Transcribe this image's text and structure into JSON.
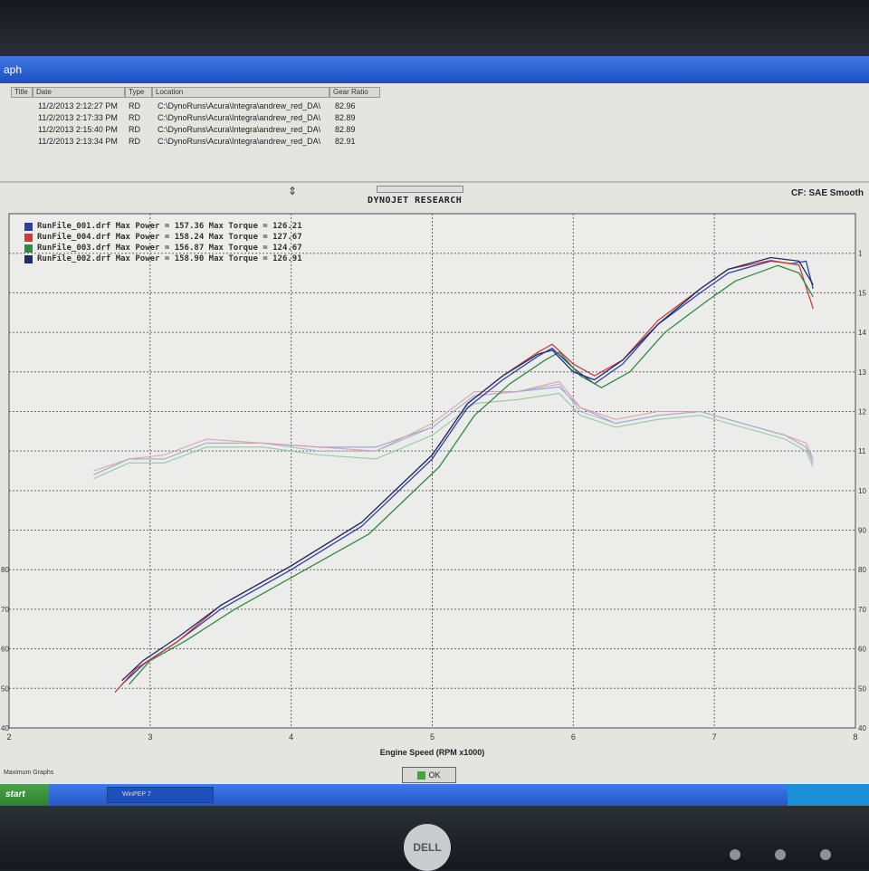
{
  "window": {
    "title": "aph"
  },
  "runs_table": {
    "headers": [
      "Title",
      "Date",
      "Type",
      "Location",
      "Gear Ratio"
    ],
    "rows": [
      {
        "date": "11/2/2013 2:12:27 PM",
        "type": "RD",
        "location": "C:\\DynoRuns\\Acura\\Integra\\andrew_red_DA\\",
        "gear": "82.96"
      },
      {
        "date": "11/2/2013 2:17:33 PM",
        "type": "RD",
        "location": "C:\\DynoRuns\\Acura\\Integra\\andrew_red_DA\\",
        "gear": "82.89"
      },
      {
        "date": "11/2/2013 2:15:40 PM",
        "type": "RD",
        "location": "C:\\DynoRuns\\Acura\\Integra\\andrew_red_DA\\",
        "gear": "82.89"
      },
      {
        "date": "11/2/2013 2:13:34 PM",
        "type": "RD",
        "location": "C:\\DynoRuns\\Acura\\Integra\\andrew_red_DA\\",
        "gear": "82.91"
      }
    ]
  },
  "brand": "DYNOJET RESEARCH",
  "correction": "CF: SAE  Smooth",
  "status_left": "Maximum Graphs",
  "ok_label": "OK",
  "taskbar": {
    "start_label": "start",
    "task_label": "WinPEP 7"
  },
  "monitor_logo": "DELL",
  "chart_data": {
    "type": "line",
    "xlabel": "Engine Speed (RPM x1000)",
    "xlim": [
      2,
      8
    ],
    "x_ticks": [
      "2",
      "3",
      "4",
      "5",
      "6",
      "7",
      "8"
    ],
    "ylim": [
      40,
      170
    ],
    "y_ticks": [
      "40",
      "50",
      "60",
      "70",
      "80",
      "90",
      "100",
      "110",
      "120",
      "130",
      "140",
      "150",
      "160"
    ],
    "y_tick_labels_right": [
      "40",
      "50",
      "60",
      "70",
      "80",
      "90",
      "10",
      "11",
      "12",
      "13",
      "14",
      "15",
      "1"
    ],
    "y_tick_labels_left": [
      "40",
      "50",
      "60",
      "70",
      "80"
    ],
    "grid": true,
    "legend": [
      {
        "name": "RunFile_001.drf",
        "power_label": "Max Power = 157.36",
        "torque_label": "Max Torque = 126.21",
        "color": "#2b3fa8"
      },
      {
        "name": "RunFile_004.drf",
        "power_label": "Max Power = 158.24",
        "torque_label": "Max Torque = 127.67",
        "color": "#d23a3a"
      },
      {
        "name": "RunFile_003.drf",
        "power_label": "Max Power = 156.87",
        "torque_label": "Max Torque = 124.67",
        "color": "#2f8a3f"
      },
      {
        "name": "RunFile_002.drf",
        "power_label": "Max Power = 158.90",
        "torque_label": "Max Torque = 126.91",
        "color": "#1a2d6b"
      }
    ],
    "power_series": [
      {
        "name": "RunFile_001.drf",
        "color": "#2b3fa8",
        "points": [
          [
            2.8,
            51
          ],
          [
            2.95,
            56
          ],
          [
            3.2,
            62
          ],
          [
            3.5,
            70
          ],
          [
            4.0,
            80
          ],
          [
            4.5,
            91
          ],
          [
            5.0,
            108
          ],
          [
            5.25,
            121
          ],
          [
            5.5,
            128
          ],
          [
            5.75,
            134
          ],
          [
            5.85,
            136
          ],
          [
            6.0,
            131
          ],
          [
            6.15,
            127
          ],
          [
            6.35,
            132
          ],
          [
            6.6,
            142
          ],
          [
            6.9,
            150
          ],
          [
            7.1,
            155
          ],
          [
            7.4,
            158
          ],
          [
            7.55,
            157.4
          ],
          [
            7.65,
            158
          ],
          [
            7.7,
            151
          ]
        ]
      },
      {
        "name": "RunFile_004.drf",
        "color": "#d23a3a",
        "points": [
          [
            2.75,
            49
          ],
          [
            2.9,
            55
          ],
          [
            3.2,
            62
          ],
          [
            3.5,
            71
          ],
          [
            4.0,
            81
          ],
          [
            4.5,
            92
          ],
          [
            5.0,
            109
          ],
          [
            5.25,
            122
          ],
          [
            5.5,
            129
          ],
          [
            5.75,
            135
          ],
          [
            5.85,
            137
          ],
          [
            6.0,
            132
          ],
          [
            6.15,
            129
          ],
          [
            6.35,
            133
          ],
          [
            6.6,
            143
          ],
          [
            6.9,
            151
          ],
          [
            7.1,
            156
          ],
          [
            7.4,
            158.2
          ],
          [
            7.6,
            157
          ],
          [
            7.7,
            146
          ]
        ]
      },
      {
        "name": "RunFile_003.drf",
        "color": "#2f8a3f",
        "points": [
          [
            2.85,
            51
          ],
          [
            3.0,
            57
          ],
          [
            3.25,
            62
          ],
          [
            3.6,
            70
          ],
          [
            4.05,
            79
          ],
          [
            4.55,
            89
          ],
          [
            5.05,
            106
          ],
          [
            5.3,
            119
          ],
          [
            5.55,
            127
          ],
          [
            5.8,
            133
          ],
          [
            5.9,
            135
          ],
          [
            6.05,
            129
          ],
          [
            6.2,
            126
          ],
          [
            6.4,
            130
          ],
          [
            6.65,
            140
          ],
          [
            6.95,
            148
          ],
          [
            7.15,
            153
          ],
          [
            7.45,
            156.9
          ],
          [
            7.6,
            155
          ],
          [
            7.7,
            149
          ]
        ]
      },
      {
        "name": "RunFile_002.drf",
        "color": "#1a2d6b",
        "points": [
          [
            2.8,
            52
          ],
          [
            2.95,
            57
          ],
          [
            3.2,
            63
          ],
          [
            3.5,
            71
          ],
          [
            4.0,
            81
          ],
          [
            4.5,
            92
          ],
          [
            5.0,
            109
          ],
          [
            5.25,
            122
          ],
          [
            5.5,
            129
          ],
          [
            5.75,
            134.5
          ],
          [
            5.85,
            135.5
          ],
          [
            6.0,
            130
          ],
          [
            6.15,
            128
          ],
          [
            6.35,
            133
          ],
          [
            6.6,
            142
          ],
          [
            6.9,
            151
          ],
          [
            7.1,
            156
          ],
          [
            7.4,
            158.9
          ],
          [
            7.6,
            158
          ],
          [
            7.7,
            152
          ]
        ]
      }
    ],
    "torque_series": [
      {
        "name": "RunFile_001.drf",
        "color": "#8f9bd6",
        "points": [
          [
            2.6,
            104
          ],
          [
            2.85,
            108
          ],
          [
            3.1,
            108
          ],
          [
            3.4,
            112
          ],
          [
            3.8,
            112
          ],
          [
            4.2,
            111
          ],
          [
            4.6,
            111
          ],
          [
            5.0,
            116
          ],
          [
            5.3,
            124
          ],
          [
            5.6,
            125
          ],
          [
            5.9,
            126.2
          ],
          [
            6.05,
            121
          ],
          [
            6.3,
            117
          ],
          [
            6.6,
            119
          ],
          [
            6.9,
            120
          ],
          [
            7.2,
            117
          ],
          [
            7.5,
            114
          ],
          [
            7.65,
            111
          ],
          [
            7.7,
            107
          ]
        ]
      },
      {
        "name": "RunFile_004.drf",
        "color": "#de9a9a",
        "points": [
          [
            2.6,
            105
          ],
          [
            2.85,
            108
          ],
          [
            3.1,
            109
          ],
          [
            3.4,
            113
          ],
          [
            3.8,
            112
          ],
          [
            4.2,
            111
          ],
          [
            4.6,
            110
          ],
          [
            5.0,
            117
          ],
          [
            5.3,
            125
          ],
          [
            5.6,
            125
          ],
          [
            5.9,
            127.6
          ],
          [
            6.05,
            121
          ],
          [
            6.3,
            118
          ],
          [
            6.6,
            120
          ],
          [
            6.9,
            120
          ],
          [
            7.2,
            117
          ],
          [
            7.5,
            114
          ],
          [
            7.65,
            112
          ],
          [
            7.7,
            108
          ]
        ]
      },
      {
        "name": "RunFile_003.drf",
        "color": "#8dc49a",
        "points": [
          [
            2.6,
            103
          ],
          [
            2.85,
            107
          ],
          [
            3.1,
            107
          ],
          [
            3.4,
            111
          ],
          [
            3.8,
            111
          ],
          [
            4.2,
            109
          ],
          [
            4.6,
            108
          ],
          [
            5.0,
            114
          ],
          [
            5.3,
            122
          ],
          [
            5.6,
            123
          ],
          [
            5.9,
            124.6
          ],
          [
            6.05,
            119
          ],
          [
            6.3,
            116
          ],
          [
            6.6,
            118
          ],
          [
            6.9,
            119
          ],
          [
            7.2,
            116
          ],
          [
            7.5,
            113
          ],
          [
            7.65,
            110
          ],
          [
            7.7,
            106
          ]
        ]
      },
      {
        "name": "RunFile_002.drf",
        "color": "#a7b1cf",
        "points": [
          [
            2.6,
            104
          ],
          [
            2.85,
            108
          ],
          [
            3.1,
            108
          ],
          [
            3.4,
            112
          ],
          [
            3.8,
            112
          ],
          [
            4.2,
            110
          ],
          [
            4.6,
            110
          ],
          [
            5.0,
            116
          ],
          [
            5.3,
            124
          ],
          [
            5.6,
            125
          ],
          [
            5.9,
            126.9
          ],
          [
            6.05,
            120
          ],
          [
            6.3,
            117
          ],
          [
            6.6,
            119
          ],
          [
            6.9,
            120
          ],
          [
            7.2,
            117
          ],
          [
            7.5,
            114
          ],
          [
            7.65,
            111
          ],
          [
            7.7,
            108
          ]
        ]
      }
    ]
  }
}
